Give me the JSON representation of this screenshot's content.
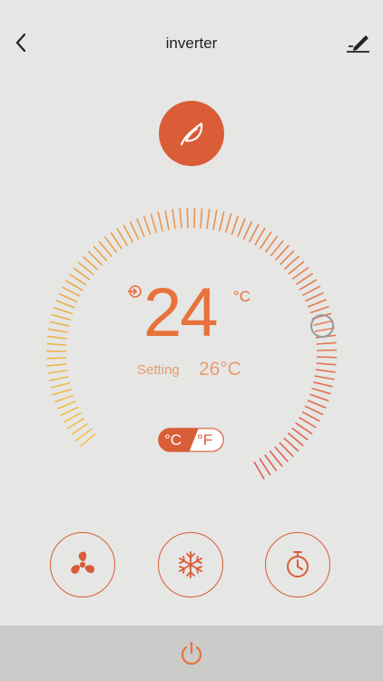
{
  "header": {
    "title": "inverter",
    "back_icon": "chevron-left-icon",
    "edit_icon": "pencil-icon"
  },
  "mode_badge": {
    "icon": "leaf-icon"
  },
  "temperature": {
    "current": "24",
    "unit": "°C",
    "setting_label": "Setting",
    "setting_value": "26°C"
  },
  "unit_toggle": {
    "celsius_label": "°C",
    "fahrenheit_label": "°F",
    "selected": "°C"
  },
  "controls": {
    "fan_icon": "fan-icon",
    "mode_icon": "snowflake-icon",
    "timer_icon": "stopwatch-icon"
  },
  "bottom_bar": {
    "power_icon": "power-icon"
  },
  "colors": {
    "accent": "#d95d37",
    "temperature": "#e8723c",
    "dial_start": "#f2c24a",
    "dial_end": "#e05d52",
    "background": "#e6e6e5",
    "bottom_bar": "#cbcbca"
  }
}
